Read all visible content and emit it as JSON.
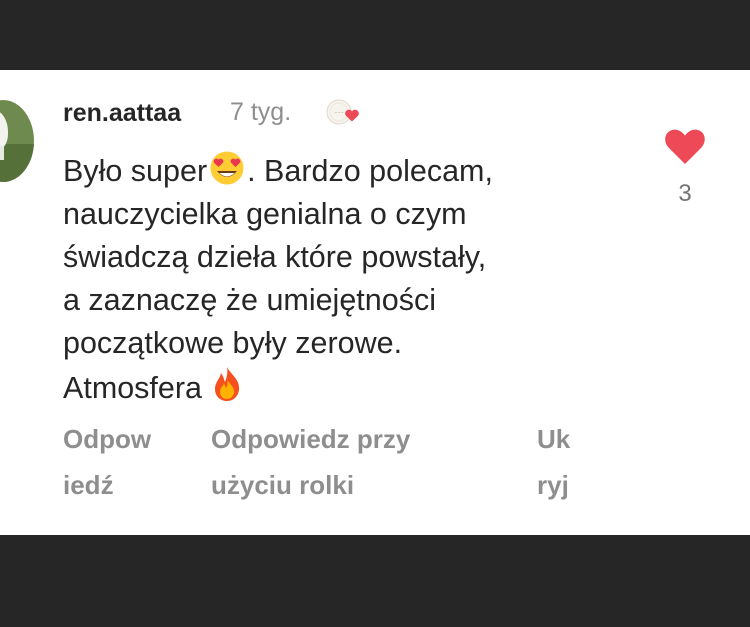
{
  "comment": {
    "username": "ren.aattaa",
    "time": "7 tyg.",
    "lines": [
      {
        "before": "Było super",
        "after": ". Bardzo polecam,"
      },
      {
        "text": "nauczycielka genialna o czym"
      },
      {
        "text": "świadczą dzieła które powstały,"
      },
      {
        "text": "a zaznaczę że umiejętności"
      },
      {
        "text": "początkowe były zerowe."
      },
      {
        "text": "Atmosfera "
      }
    ],
    "emojis": {
      "line1": "heart-eyes-emoji",
      "line6": "fire-emoji"
    },
    "like_count": "3",
    "like_color": "#ed4956"
  },
  "actions": {
    "reply": {
      "line1": "Odpow",
      "line2": "iedź"
    },
    "reply_reel": {
      "line1": "Odpowiedz przy",
      "line2": "użyciu rolki"
    },
    "hide": {
      "line1": "Uk",
      "line2": "ryj"
    }
  },
  "colors": {
    "text": "#262626",
    "secondary": "#8e8e8e",
    "background": "#ffffff",
    "frame": "#262626"
  }
}
